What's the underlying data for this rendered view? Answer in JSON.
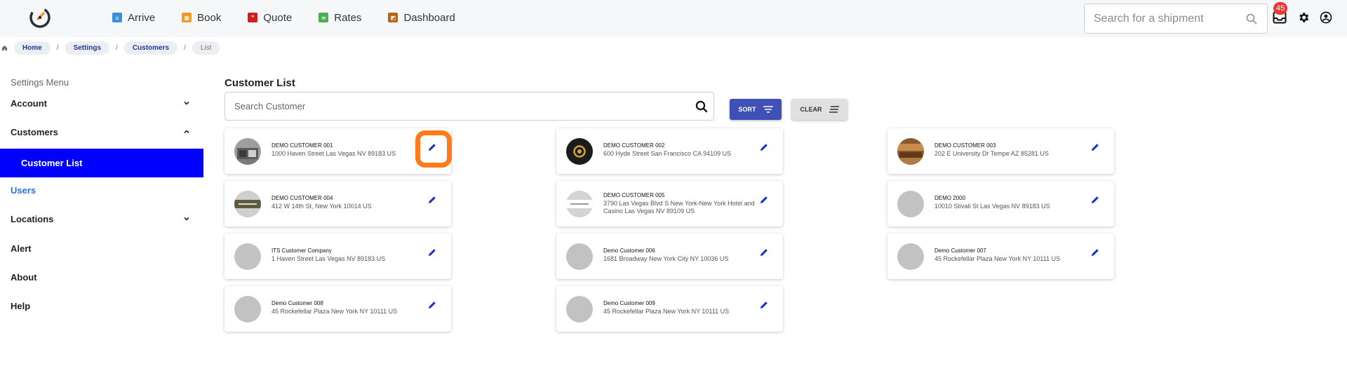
{
  "nav": {
    "items": [
      {
        "label": "Arrive",
        "icon": "home-icon",
        "color": "#3a8fd8"
      },
      {
        "label": "Book",
        "icon": "booking-icon",
        "color": "#f39a25"
      },
      {
        "label": "Quote",
        "icon": "quote-icon",
        "color": "#d01f1f"
      },
      {
        "label": "Rates",
        "icon": "rates-icon",
        "color": "#4caf50"
      },
      {
        "label": "Dashboard",
        "icon": "dashboard-icon",
        "color": "#b7651b"
      }
    ],
    "search_placeholder": "Search for a shipment",
    "inbox_count": "45"
  },
  "breadcrumb": {
    "items": [
      "Home",
      "Settings",
      "Customers",
      "List"
    ],
    "sep": "/"
  },
  "sidebar": {
    "title": "Settings Menu",
    "items": [
      {
        "label": "Account"
      },
      {
        "label": "Customers"
      },
      {
        "label": "Customer List"
      },
      {
        "label": "Users"
      },
      {
        "label": "Locations"
      },
      {
        "label": "Alert"
      },
      {
        "label": "About"
      },
      {
        "label": "Help"
      }
    ]
  },
  "main": {
    "title": "Customer List",
    "search_placeholder": "Search Customer",
    "sort_label": "SORT",
    "clear_label": "CLEAR"
  },
  "customers": [
    {
      "name": "DEMO CUSTOMER 001",
      "address": "1000 Haven Street Las Vegas NV 89183 US",
      "avatar": "photo-warehouse"
    },
    {
      "name": "DEMO CUSTOMER 002",
      "address": "600 Hyde Street San Francisco CA 94109 US",
      "avatar": "logo-gold"
    },
    {
      "name": "DEMO CUSTOMER 003",
      "address": "202 E University Dr Tempe AZ 85281 US",
      "avatar": "photo-brown"
    },
    {
      "name": "DEMO CUSTOMER 004",
      "address": "412 W 14th St, New York 10014 US",
      "avatar": "logo-olive"
    },
    {
      "name": "DEMO CUSTOMER 005",
      "address": "3790 Las Vegas Blvd S New York-New York Hotel and Casino Las Vegas NV 89109 US",
      "avatar": "logo-white"
    },
    {
      "name": "DEMO 2000",
      "address": "10010 Stivali St Las Vegas NV 89183 US",
      "avatar": "placeholder"
    },
    {
      "name": "ITS Customer Company",
      "address": "1 Haven Street Las Vegas NV 89183 US",
      "avatar": "placeholder"
    },
    {
      "name": "Demo Customer 006",
      "address": "1681 Broadway New York City NY 10036 US",
      "avatar": "placeholder"
    },
    {
      "name": "Demo Customer 007",
      "address": "45 Rockefellar Plaza New York NY 10111 US",
      "avatar": "placeholder"
    },
    {
      "name": "Demo Customer 008",
      "address": "45 Rockefellar Plaza New York NY 10111 US",
      "avatar": "placeholder"
    },
    {
      "name": "Demo Customer 009",
      "address": "45 Rockefellar Plaza New York NY 10111 US",
      "avatar": "placeholder"
    }
  ],
  "colors": {
    "accent": "#3f51b5",
    "active_menu": "#0000ff",
    "link": "#2a6fd6",
    "highlight": "#ff7a1a",
    "badge": "#e53935"
  }
}
